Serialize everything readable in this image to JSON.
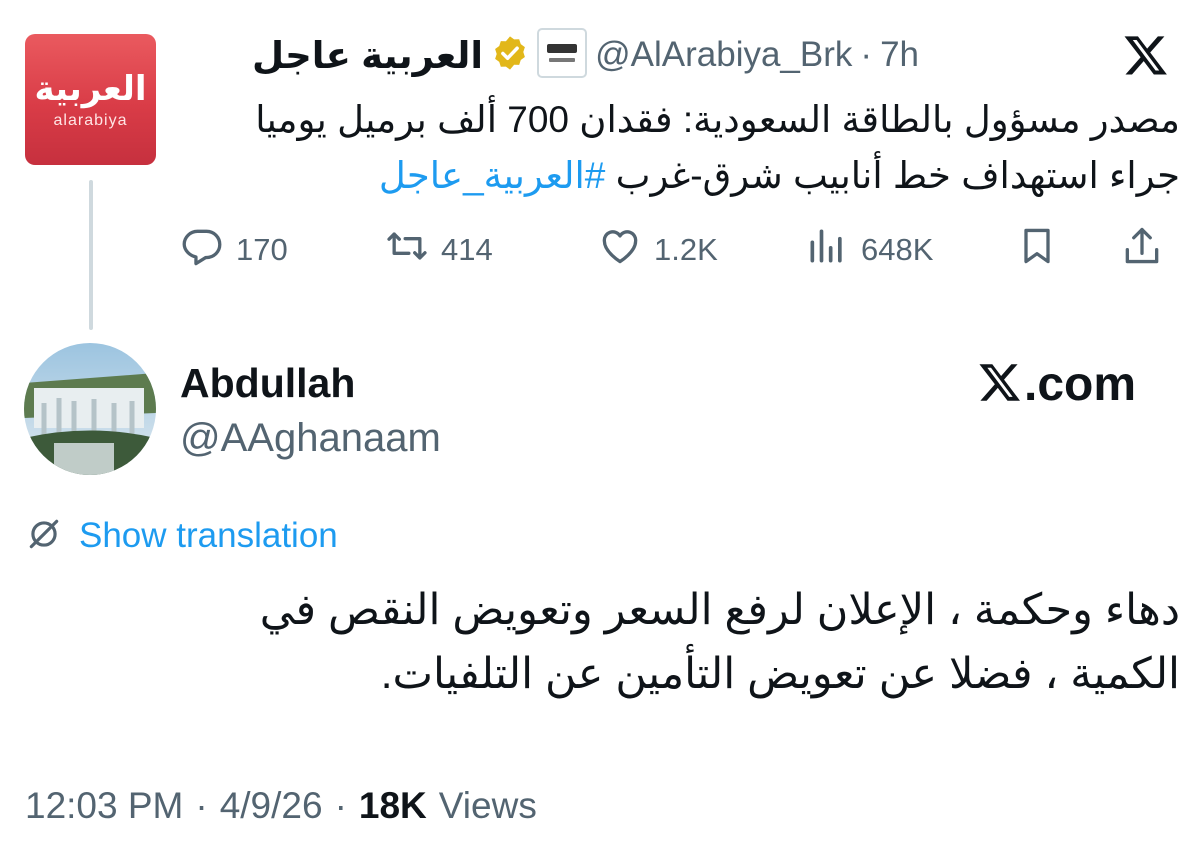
{
  "quoted_tweet": {
    "logo": {
      "arabic": "العربية",
      "latin": "alarabiya"
    },
    "author_name": "العربية عاجل",
    "handle": "@AlArabiya_Brk",
    "separator": "·",
    "time": "7h",
    "text_main": "مصدر مسؤول بالطاقة السعودية: فقدان 700 ألف برميل يوميا جراء استهداف خط أنابيب شرق-غرب",
    "hashtag": "#العربية_عاجل",
    "stats": {
      "replies": "170",
      "reposts": "414",
      "likes": "1.2K",
      "views": "648K"
    },
    "icons": [
      "verified-badge-icon",
      "reply-icon",
      "repost-icon",
      "like-icon",
      "views-icon",
      "bookmark-icon",
      "share-icon",
      "x-logo-icon"
    ]
  },
  "main_tweet": {
    "name": "Abdullah",
    "handle": "@AAghanaam",
    "brand": ".com",
    "show_translation": "Show translation",
    "text": "دهاء وحكمة ، الإعلان لرفع السعر وتعويض النقص في الكمية ، فضلا عن تعويض التأمين عن التلفيات.",
    "footer": {
      "time": "12:03 PM",
      "sep1": "·",
      "date": "4/9/26",
      "sep2": "·",
      "views_count": "18K",
      "views_label": "Views"
    }
  },
  "colors": {
    "link": "#1d9bf0",
    "muted": "#536471",
    "text": "#0f1419",
    "brand_red": "#d93c47",
    "verified_gold": "#e2b719"
  }
}
